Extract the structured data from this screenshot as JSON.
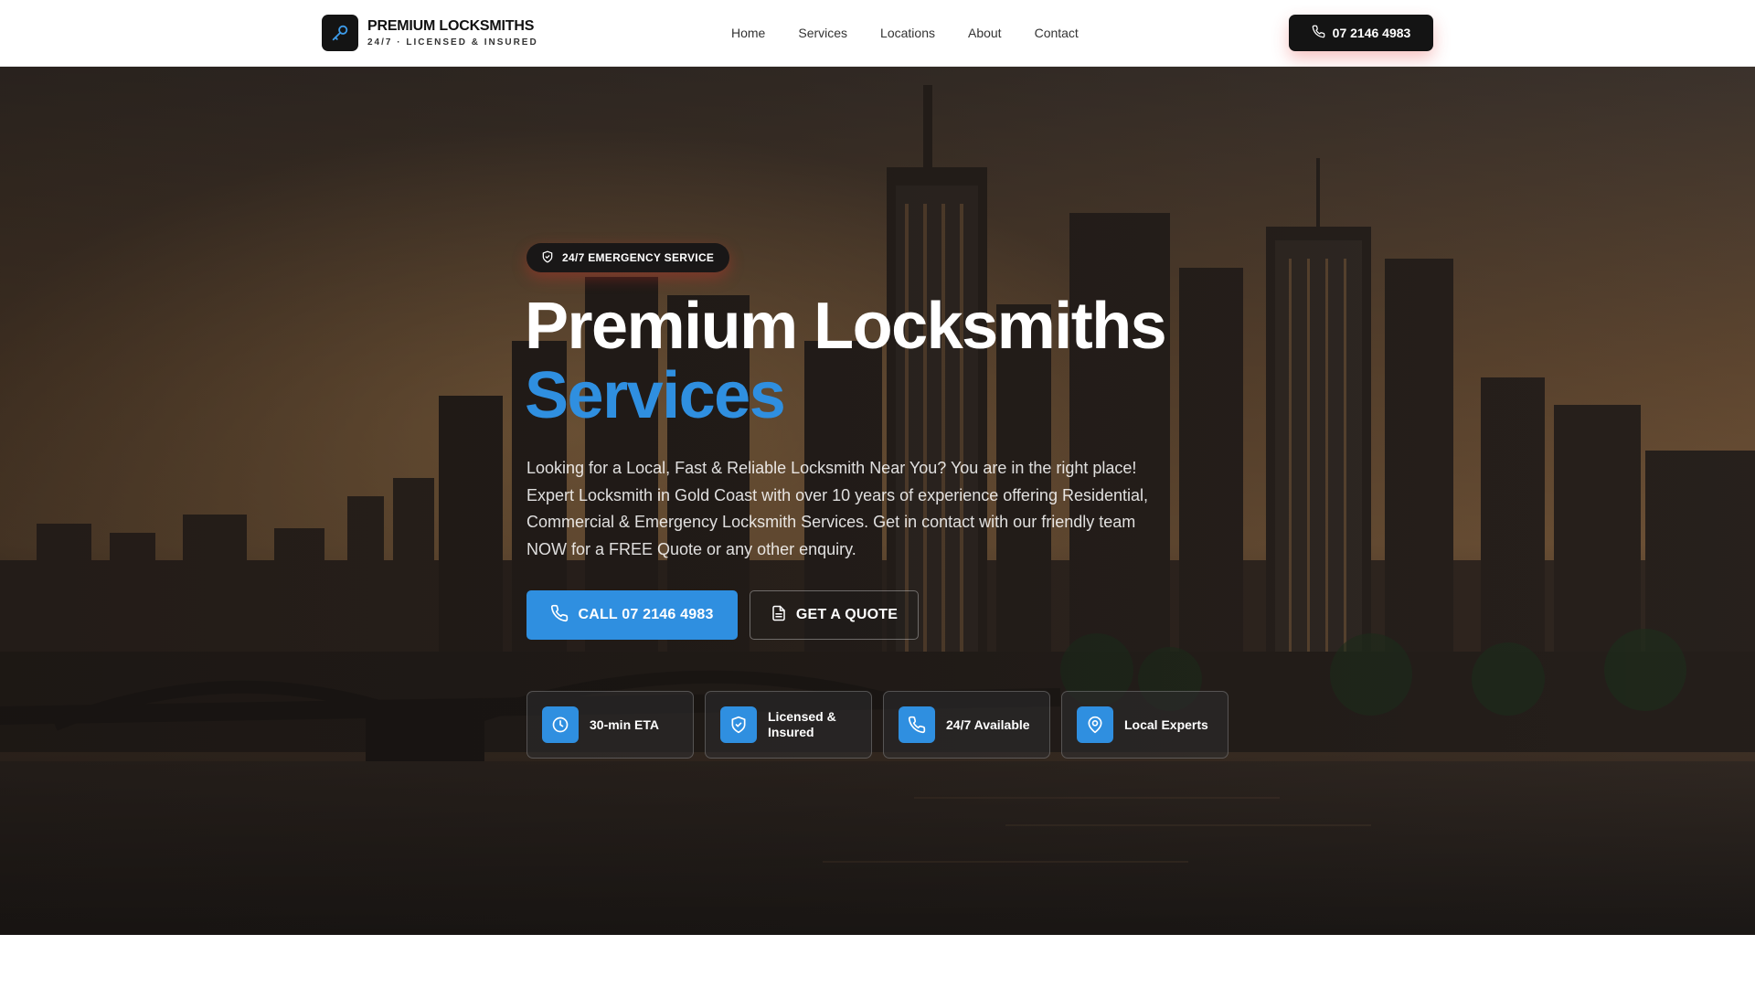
{
  "brand": {
    "title": "PREMIUM LOCKSMITHS",
    "subtitle": "24/7 · LICENSED & INSURED",
    "logo_icon": "key-icon"
  },
  "nav": {
    "items": [
      {
        "label": "Home"
      },
      {
        "label": "Services"
      },
      {
        "label": "Locations"
      },
      {
        "label": "About"
      },
      {
        "label": "Contact"
      }
    ],
    "call_label": "07 2146 4983",
    "call_icon": "phone-icon"
  },
  "hero": {
    "badge": "24/7 EMERGENCY SERVICE",
    "badge_icon": "shield-check-icon",
    "title_line1": "Premium Locksmiths",
    "title_line2": "Services",
    "lead": "Looking for a Local, Fast & Reliable Locksmith Near You? You are in the right place! Expert Locksmith in Gold Coast with over 10 years of experience offering Residential, Commercial & Emergency Locksmith Services. Get in contact with our friendly team NOW for a FREE Quote or any other enquiry.",
    "primary_button": "CALL 07 2146 4983",
    "secondary_button": "GET A QUOTE",
    "features": [
      {
        "label": "30-min ETA",
        "icon": "clock-icon"
      },
      {
        "label": "Licensed & Insured",
        "icon": "shield-check-icon"
      },
      {
        "label": "24/7 Available",
        "icon": "phone-icon"
      },
      {
        "label": "Local Experts",
        "icon": "map-pin-icon"
      }
    ]
  },
  "colors": {
    "accent": "#2f8fe0",
    "dark": "#141414",
    "glow": "#e53935"
  }
}
